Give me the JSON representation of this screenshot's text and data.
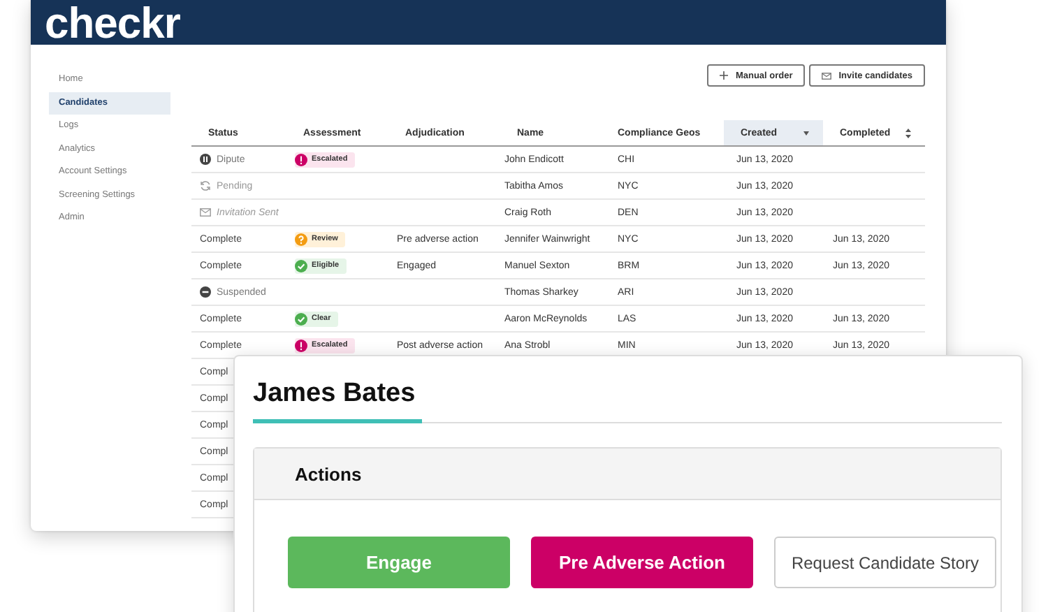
{
  "app": {
    "logo": "checkr",
    "sidebar": {
      "items": [
        {
          "label": "Home",
          "selected": false
        },
        {
          "label": "Candidates",
          "selected": true
        },
        {
          "label": "Logs",
          "selected": false
        },
        {
          "label": "Analytics",
          "selected": false
        },
        {
          "label": "Account Settings",
          "selected": false
        },
        {
          "label": "Screening Settings",
          "selected": false
        },
        {
          "label": "Admin",
          "selected": false
        }
      ]
    },
    "toolbar": {
      "buttons": [
        {
          "kind": "plus",
          "label": "Manual order"
        },
        {
          "kind": "mail",
          "label": "Invite candidates"
        }
      ]
    },
    "table": {
      "columns": [
        {
          "label": "Status",
          "selected": false
        },
        {
          "label": "Assessment",
          "selected": false
        },
        {
          "label": "Adjudication",
          "selected": false
        },
        {
          "label": "Name",
          "selected": false
        },
        {
          "label": "Compliance Geos",
          "selected": false
        },
        {
          "label": "Created",
          "selected": true,
          "kind": "descending"
        },
        {
          "label": "Completed",
          "selected": false,
          "kind": "sortable"
        }
      ],
      "rows": [
        {
          "status": {
            "kind": "dispute",
            "text": "Dipute"
          },
          "assessment": {
            "kind": "escalated",
            "label": "Escalated"
          },
          "name": "John Endicott",
          "geo": "CHI",
          "created": "Jun 13, 2020"
        },
        {
          "status": {
            "kind": "pending",
            "text": "Pending"
          },
          "name": "Tabitha Amos",
          "geo": "NYC",
          "created": "Jun 13, 2020"
        },
        {
          "status": {
            "kind": "invitation",
            "text": "Invitation Sent"
          },
          "name": "Craig Roth",
          "geo": "DEN",
          "created": "Jun 13, 2020"
        },
        {
          "status": {
            "kind": "complete",
            "text": "Complete"
          },
          "assessment": {
            "kind": "review",
            "label": "Review"
          },
          "adjudication": "Pre adverse action",
          "name": "Jennifer Wainwright",
          "geo": "NYC",
          "created": "Jun 13, 2020",
          "completed": "Jun 13, 2020"
        },
        {
          "status": {
            "kind": "complete",
            "text": "Complete"
          },
          "assessment": {
            "kind": "eligible",
            "label": "Eligible"
          },
          "adjudication": "Engaged",
          "name": "Manuel Sexton",
          "geo": "BRM",
          "created": "Jun 13, 2020",
          "completed": "Jun 13, 2020"
        },
        {
          "status": {
            "kind": "suspended",
            "text": "Suspended"
          },
          "name": "Thomas Sharkey",
          "geo": "ARI",
          "created": "Jun 13, 2020"
        },
        {
          "status": {
            "kind": "complete",
            "text": "Complete"
          },
          "assessment": {
            "kind": "clear",
            "label": "Clear"
          },
          "name": "Aaron McReynolds",
          "geo": "LAS",
          "created": "Jun 13, 2020",
          "completed": "Jun 13, 2020"
        },
        {
          "status": {
            "kind": "complete",
            "text": "Complete"
          },
          "assessment": {
            "kind": "escalated",
            "label": "Escalated"
          },
          "adjudication": "Post adverse action",
          "name": "Ana Strobl",
          "geo": "MIN",
          "created": "Jun 13, 2020",
          "completed": "Jun 13, 2020"
        },
        {
          "status": {
            "kind": "complete",
            "text": "Compl"
          }
        },
        {
          "status": {
            "kind": "complete",
            "text": "Compl"
          }
        },
        {
          "status": {
            "kind": "complete",
            "text": "Compl"
          }
        },
        {
          "status": {
            "kind": "complete",
            "text": "Compl"
          }
        },
        {
          "status": {
            "kind": "complete",
            "text": "Compl"
          }
        },
        {
          "status": {
            "kind": "complete",
            "text": "Compl"
          }
        }
      ]
    }
  },
  "panel": {
    "title": "James Bates",
    "card": {
      "title": "Actions",
      "buttons": [
        {
          "kind": "engage",
          "label": "Engage"
        },
        {
          "kind": "adverse",
          "label": "Pre Adverse Action"
        },
        {
          "kind": "story",
          "label": "Request Candidate Story"
        }
      ]
    }
  }
}
